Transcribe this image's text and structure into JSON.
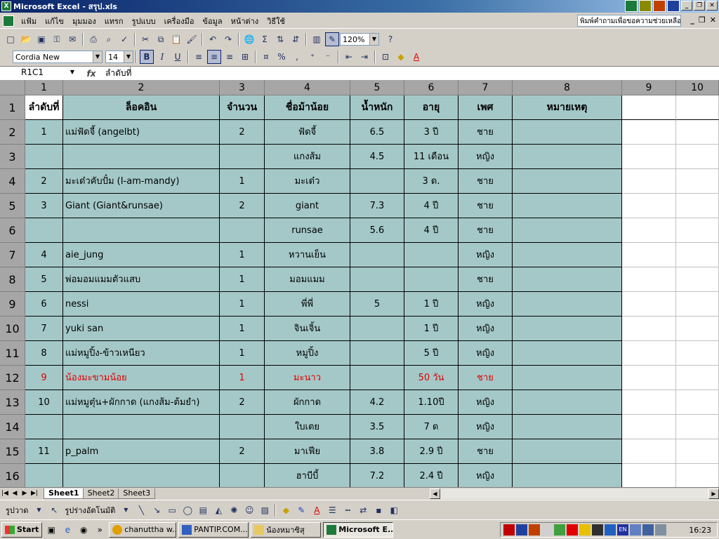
{
  "window": {
    "title": "Microsoft Excel - สรุป.xls"
  },
  "menu": {
    "items": [
      "แฟ้ม",
      "แก้ไข",
      "มุมมอง",
      "แทรก",
      "รูปแบบ",
      "เครื่องมือ",
      "ข้อมูล",
      "หน้าต่าง",
      "วิธีใช้"
    ],
    "help_placeholder": "พิมพ์คำถามเพื่อขอความช่วยเหลือ"
  },
  "toolbar": {
    "zoom": "120%",
    "font_name": "Cordia New",
    "font_size": "14"
  },
  "formula_bar": {
    "cell_ref": "R1C1",
    "fx": "fx",
    "content": "ลำดับที่"
  },
  "columns": [
    "1",
    "2",
    "3",
    "4",
    "5",
    "6",
    "7",
    "8",
    "9",
    "10"
  ],
  "rows": [
    "1",
    "2",
    "3",
    "4",
    "5",
    "6",
    "7",
    "8",
    "9",
    "10",
    "11",
    "12",
    "13",
    "14",
    "15",
    "16"
  ],
  "table": {
    "headers": [
      "ลำดับที่",
      "ล็อคอิน",
      "จำนวน",
      "ชื่อม้าน้อย",
      "น้ำหนัก",
      "อายุ",
      "เพศ",
      "หมายเหตุ"
    ],
    "data": [
      [
        "1",
        "แม่ฟัดจี้ (angelbt)",
        "2",
        "ฟัดจี้",
        "6.5",
        "3 ปี",
        "ชาย",
        ""
      ],
      [
        "",
        "",
        "",
        "แกงส้ม",
        "4.5",
        "11 เดือน",
        "หญิง",
        ""
      ],
      [
        "2",
        "มะเด๋วคับปั๋ม (I-am-mandy)",
        "1",
        "มะเด๋ว",
        "",
        "3 ด.",
        "ชาย",
        ""
      ],
      [
        "3",
        "Giant  (Giant&runsae)",
        "2",
        "giant",
        "7.3",
        "4 ปี",
        "ชาย",
        ""
      ],
      [
        "",
        "",
        "",
        "runsae",
        "5.6",
        "4 ปี",
        "ชาย",
        ""
      ],
      [
        "4",
        "aie_jung",
        "1",
        "หวานเย็น",
        "",
        "",
        "หญิง",
        ""
      ],
      [
        "5",
        "พ่อมอมแมมตัวแสบ",
        "1",
        "มอมแมม",
        "",
        "",
        "ชาย",
        ""
      ],
      [
        "6",
        "nessi",
        "1",
        "พี่พี่",
        "5",
        "1 ปี",
        "หญิง",
        ""
      ],
      [
        "7",
        "yuki san",
        "1",
        "จินเจิ้น",
        "",
        "1 ปี",
        "หญิง",
        ""
      ],
      [
        "8",
        "แม่หมูปิ้ง-ข้าวเหนียว",
        "1",
        "หมูปิ้ง",
        "",
        "5 ปี",
        "หญิง",
        ""
      ],
      [
        "9",
        "น้องมะขามน้อย",
        "1",
        "มะนาว",
        "",
        "50 วัน",
        "ชาย",
        ""
      ],
      [
        "10",
        "แม่หมูตุ๋น+ผักกาด (แกงส้ม-ต้มยำ)",
        "2",
        "ผักกาด",
        "4.2",
        "1.10ปี",
        "หญิง",
        ""
      ],
      [
        "",
        "",
        "",
        "ใบเตย",
        "3.5",
        "7 ด",
        "หญิง",
        ""
      ],
      [
        "11",
        "p_palm",
        "2",
        "มาเฟีย",
        "3.8",
        "2.9 ปี",
        "ชาย",
        ""
      ],
      [
        "",
        "",
        "",
        "ฮาบีบี้",
        "7.2",
        "2.4 ปี",
        "หญิง",
        ""
      ]
    ],
    "red_row_index": 10,
    "fill_color": "#a4c8c8",
    "highlight_color": "#e00000"
  },
  "sheets": [
    "Sheet1",
    "Sheet2",
    "Sheet3"
  ],
  "drawing": {
    "draw_label": "รูปวาด",
    "autoshapes_label": "รูปร่างอัตโนมัติ"
  },
  "taskbar": {
    "start": "Start",
    "tasks": [
      "chanuttha w...",
      "PANTIP.COM...",
      "น้องหมาซิสุ",
      "Microsoft E..."
    ],
    "clock": "16:23",
    "lang": "EN"
  }
}
